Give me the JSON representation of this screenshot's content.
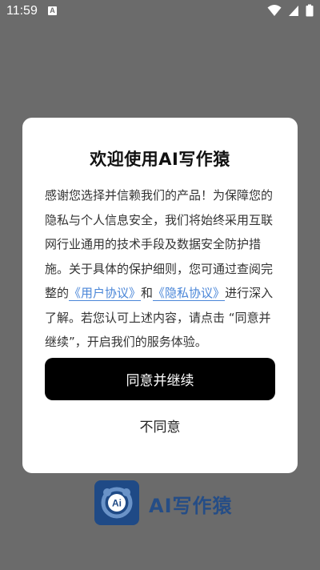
{
  "status_bar": {
    "time": "11:59",
    "notification_icon_letter": "A",
    "icons": [
      "wifi-icon",
      "cellular-icon",
      "battery-icon"
    ]
  },
  "dialog": {
    "title": "欢迎使用AI写作猿",
    "body_intro": "感谢您选择并信赖我们的产品！为保障您的隐私与个人信息安全，我们将始终采用互联网行业通用的技术手段及数据安全防护措施。关于具体的保护细则，您可通过查阅完整的",
    "user_agreement_link": "《用户协议》",
    "conjunction": "和",
    "privacy_link": "《隐私协议》",
    "body_outro": "进行深入了解。若您认可上述内容，请点击 “同意并继续”，开启我们的服务体验。",
    "agree_button": "同意并继续",
    "disagree_button": "不同意"
  },
  "brand": {
    "app_name": "AI写作猿",
    "logo_text": "Ai"
  },
  "colors": {
    "overlay": "#6b6b6b",
    "dialog_bg": "#ffffff",
    "primary_button": "#000000",
    "link": "#4a86d8",
    "brand": "#254d86"
  }
}
